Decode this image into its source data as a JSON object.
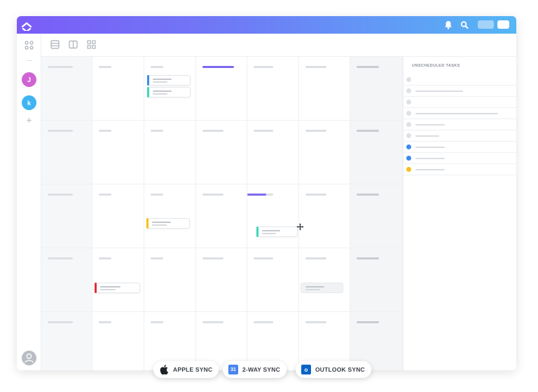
{
  "panel": {
    "title": "UNSCHEDULED TASKS"
  },
  "sidebar": {
    "avatars": [
      {
        "initial": "J",
        "color": "#d064d4"
      },
      {
        "initial": "k",
        "color": "#3fb4f2"
      }
    ],
    "add_label": "+"
  },
  "colors": {
    "topbar_start": "#7b5cf7",
    "topbar_end": "#55b6f5",
    "purple_marker": "#7c6bf0",
    "blue": "#3b8bef",
    "teal": "#3fd7b8",
    "yellow": "#f6c01c",
    "red": "#e22c3a"
  },
  "unscheduled_dots": [
    "#dfe1e5",
    "#dfe1e5",
    "#dfe1e5",
    "#dfe1e5",
    "#dfe1e5",
    "#dfe1e5",
    "#3b8bef",
    "#3b8bef",
    "#f6c01c"
  ],
  "sync_buttons": [
    {
      "icon": "apple-icon",
      "label": "APPLE SYNC"
    },
    {
      "icon": "google-calendar-icon",
      "icon_text": "31",
      "label": "2-WAY SYNC"
    },
    {
      "icon": "outlook-icon",
      "icon_text": "o",
      "label": "OUTLOOK SYNC"
    }
  ]
}
